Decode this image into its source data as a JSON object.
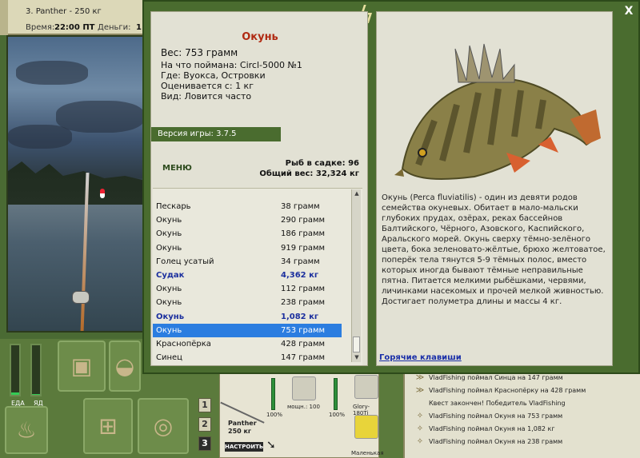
{
  "top": {
    "player": "3. Panther - 250 кг",
    "time_label": "Время:",
    "time_value": "22:00 ПТ",
    "money_label": "Деньги:",
    "money_value": "1"
  },
  "meters": {
    "food_label": "ЕДА",
    "poison_label": "ЯД",
    "food_level": 0.05,
    "poison_level": 0.02,
    "colors": {
      "fill": "#33cc55"
    }
  },
  "numbers": [
    "1",
    "2",
    "3"
  ],
  "tackle": {
    "owner": "Panther",
    "weight": "250 кг",
    "rod_pct": "100%",
    "reel_label": "мощн.: 100",
    "reel_pct": "100%",
    "line_label": "Glory-180Ti",
    "lure_label": "Маленькая",
    "set_button": "НАСТРОИТЬ"
  },
  "feed": [
    "VladFishing поймал Синца на 147 грамм",
    "VladFishing поймал Краснопёрку на 428 грамм",
    "Квест закончен! Победитель VladFishing",
    "VladFishing поймал Окуня на 753 грамм",
    "VladFishing поймал Окуня на 1,082 кг",
    "VladFishing поймал Окуня на 238 грамм"
  ],
  "modal": {
    "close": "X",
    "fish_name": "Окунь",
    "weight": "Вес: 753 грамм",
    "caught_on": "На что поймана: Circl-5000 №1",
    "where": "Где: Вуокса, Островки",
    "valued_from": "Оценивается с: 1 кг",
    "view": "Вид: Ловится часто",
    "version": "Версия игры: 3.7.5",
    "menu": "МЕНЮ",
    "in_keepnet": "Рыб в садке: 96",
    "total_weight": "Общий вес: 32,324 кг",
    "catch": [
      {
        "name": "Пескарь",
        "weight": "38 грамм",
        "big": false,
        "selected": false
      },
      {
        "name": "Окунь",
        "weight": "290 грамм",
        "big": false,
        "selected": false
      },
      {
        "name": "Окунь",
        "weight": "186 грамм",
        "big": false,
        "selected": false
      },
      {
        "name": "Окунь",
        "weight": "919 грамм",
        "big": false,
        "selected": false
      },
      {
        "name": "Голец усатый",
        "weight": "34 грамм",
        "big": false,
        "selected": false
      },
      {
        "name": "Судак",
        "weight": "4,362 кг",
        "big": true,
        "selected": false
      },
      {
        "name": "Окунь",
        "weight": "112 грамм",
        "big": false,
        "selected": false
      },
      {
        "name": "Окунь",
        "weight": "238 грамм",
        "big": false,
        "selected": false
      },
      {
        "name": "Окунь",
        "weight": "1,082 кг",
        "big": true,
        "selected": false
      },
      {
        "name": "Окунь",
        "weight": "753 грамм",
        "big": false,
        "selected": true
      },
      {
        "name": "Краснопёрка",
        "weight": "428 грамм",
        "big": false,
        "selected": false
      },
      {
        "name": "Синец",
        "weight": "147 грамм",
        "big": false,
        "selected": false
      }
    ],
    "description": "Окунь (Perca fluviatilis) - один из девяти родов семейства окуневых. Обитает в мало-мальски глубоких прудах, озёрах, реках бассейнов Балтийского, Чёрного, Азовского, Каспийского, Аральского морей. Окунь сверху тёмно-зелёного цвета, бока зеленовато-жёлтые, брюхо желтоватое, поперёк тела тянутся 5-9 тёмных полос, вместо которых иногда бывают тёмные неправильные пятна. Питается мелкими рыбёшками, червями, личинками насекомых и прочей мелкой живностью. Достигает полуметра длины и массы 4 кг.",
    "hotkeys": "Горячие клавиши"
  }
}
